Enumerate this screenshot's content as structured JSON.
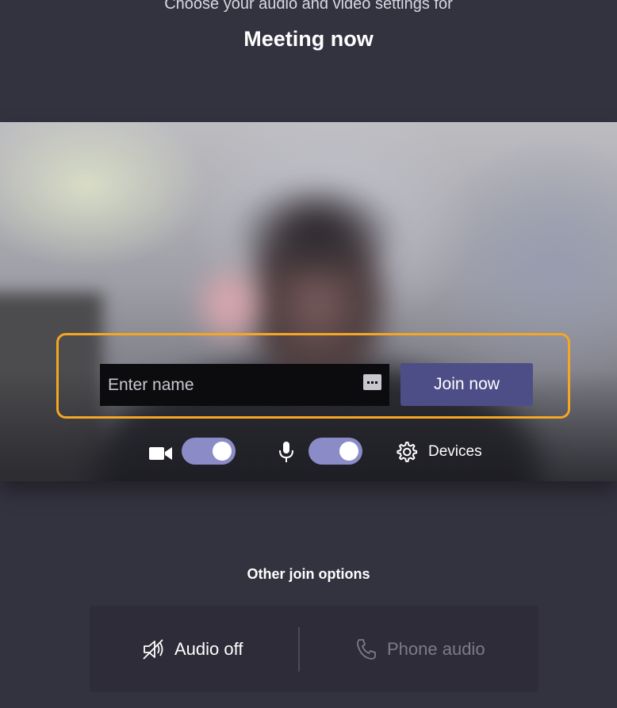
{
  "header": {
    "subtitle": "Choose your audio and video settings for",
    "meeting_title": "Meeting now"
  },
  "join": {
    "name_placeholder": "Enter name",
    "join_button_label": "Join now"
  },
  "controls": {
    "video_on": true,
    "audio_on": true,
    "devices_label": "Devices"
  },
  "other_options": {
    "title": "Other join options",
    "audio_off_label": "Audio off",
    "phone_audio_label": "Phone audio"
  },
  "colors": {
    "background": "#33323f",
    "accent": "#4d4e87",
    "toggle_on": "#8b8cc7",
    "highlight": "#f5a623"
  }
}
